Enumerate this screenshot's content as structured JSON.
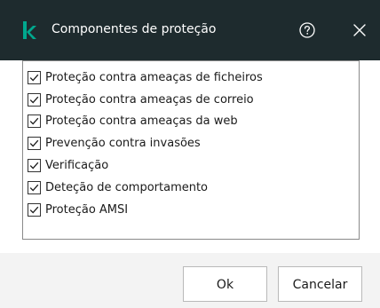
{
  "window": {
    "title": "Componentes de proteção",
    "logo_icon": "kaspersky-k-logo",
    "help_icon": "help-circle-icon",
    "close_icon": "close-x-icon",
    "titlebar_color": "#1e2b2e",
    "accent_color": "#00a88e"
  },
  "components": {
    "items": [
      {
        "label": "Proteção contra ameaças de ficheiros",
        "checked": true
      },
      {
        "label": "Proteção contra ameaças de correio",
        "checked": true
      },
      {
        "label": "Proteção contra ameaças da web",
        "checked": true
      },
      {
        "label": "Prevenção contra invasões",
        "checked": true
      },
      {
        "label": "Verificação",
        "checked": true
      },
      {
        "label": "Deteção de comportamento",
        "checked": true
      },
      {
        "label": "Proteção AMSI",
        "checked": true
      }
    ]
  },
  "footer": {
    "ok_label": "Ok",
    "cancel_label": "Cancelar"
  }
}
